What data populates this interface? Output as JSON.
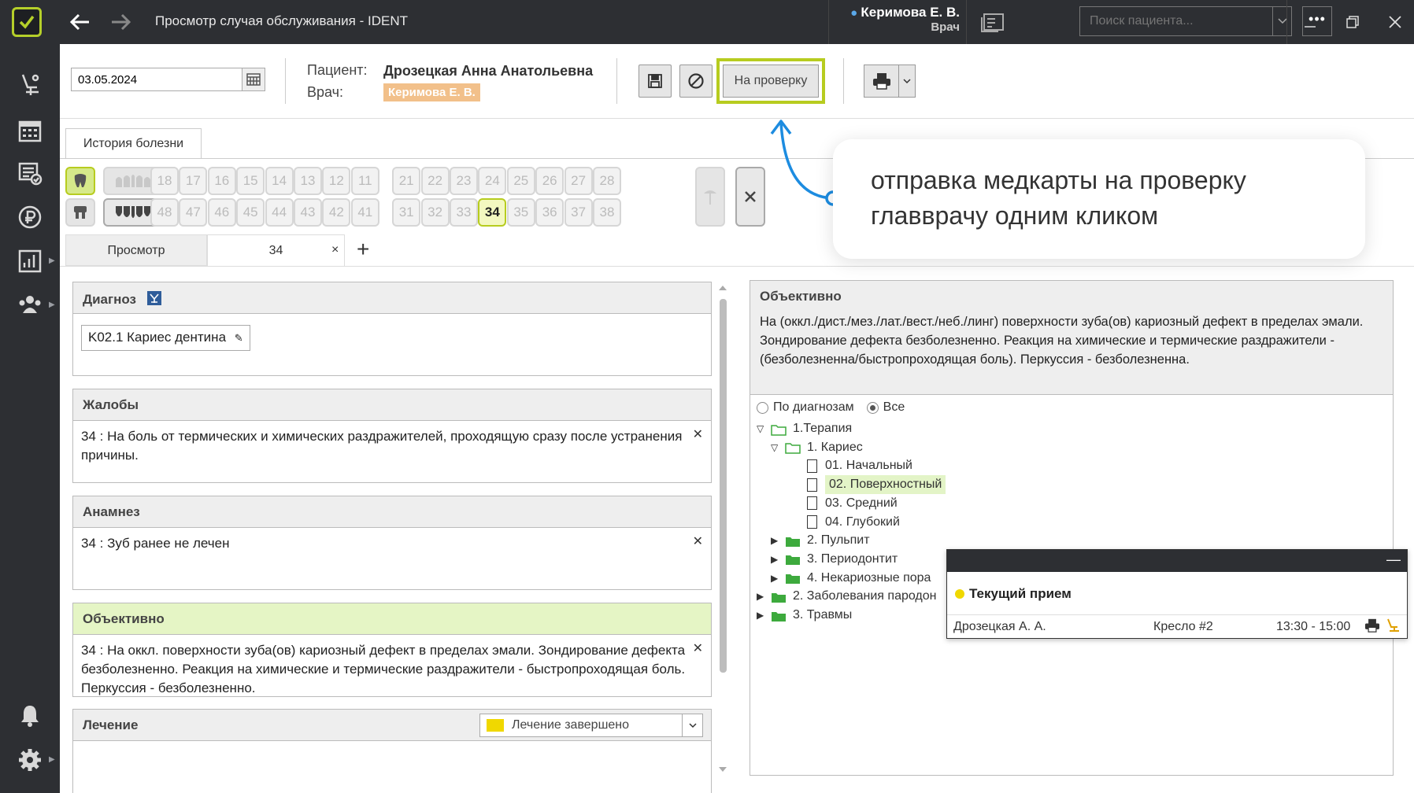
{
  "window": {
    "title": "Просмотр случая обслуживания - IDENT",
    "user_name": "Керимова Е. В.",
    "user_role": "Врач",
    "search_placeholder": "Поиск пациента...",
    "more_label": "•••"
  },
  "header": {
    "date": "03.05.2024",
    "patient_label": "Пациент:",
    "patient_name": "Дрозецкая Анна Анатольевна",
    "doctor_label": "Врач:",
    "doctor_name": "Керимова Е. В.",
    "check_button": "На проверку",
    "doctor_tag_color": "#f2c08a",
    "highlight_color": "#b7cc1f"
  },
  "tabs": {
    "history": "История болезни",
    "view": "Просмотр",
    "tooth_tab": "34",
    "close": "×",
    "add": "+"
  },
  "teeth": {
    "upper": [
      "18",
      "17",
      "16",
      "15",
      "14",
      "13",
      "12",
      "11",
      "21",
      "22",
      "23",
      "24",
      "25",
      "26",
      "27",
      "28"
    ],
    "lower": [
      "48",
      "47",
      "46",
      "45",
      "44",
      "43",
      "42",
      "41",
      "31",
      "32",
      "33",
      "34",
      "35",
      "36",
      "37",
      "38"
    ],
    "selected": "34"
  },
  "panels": {
    "diagnosis": {
      "title": "Диагноз",
      "tag": "K02.1 Кариес дентина"
    },
    "complaints": {
      "title": "Жалобы",
      "text": "34 : На боль от термических и химических раздражителей, проходящую сразу после устранения причины."
    },
    "anamnesis": {
      "title": "Анамнез",
      "text": "34 : Зуб ранее не лечен"
    },
    "objective": {
      "title": "Объективно",
      "text": "34 : На оккл. поверхности зуба(ов) кариозный дефект в пределах эмали. Зондирование дефекта безболезненно. Реакция на химические и термические раздражители - быстропроходящая боль. Перкуссия - безболезненно."
    },
    "treatment": {
      "title": "Лечение",
      "status": "Лечение завершено",
      "status_color": "#f0d800"
    }
  },
  "right": {
    "title": "Объективно",
    "text": "На (оккл./дист./мез./лат./вест./неб./линг) поверхности зуба(ов) кариозный дефект в пределах эмали. Зондирование дефекта безболезненно. Реакция на химические и термические раздражители - (безболезненна/быстропроходящая боль). Перкуссия - безболезненна.",
    "radio_by_diag": "По диагнозам",
    "radio_all": "Все",
    "tree": [
      {
        "label": "1.Терапия",
        "kind": "folder-open",
        "level": 0,
        "arrow": "open"
      },
      {
        "label": "1. Кариес",
        "kind": "folder-open",
        "level": 1,
        "arrow": "open"
      },
      {
        "label": "01. Начальный",
        "kind": "doc",
        "level": 2
      },
      {
        "label": "02. Поверхностный",
        "kind": "doc",
        "level": 2,
        "highlight": true
      },
      {
        "label": "03. Средний",
        "kind": "doc",
        "level": 2
      },
      {
        "label": "04. Глубокий",
        "kind": "doc",
        "level": 2
      },
      {
        "label": "2. Пульпит",
        "kind": "folder",
        "level": 1,
        "arrow": "closed"
      },
      {
        "label": "3. Периодонтит",
        "kind": "folder",
        "level": 1,
        "arrow": "closed"
      },
      {
        "label": "4. Некариозные пора",
        "kind": "folder",
        "level": 1,
        "arrow": "closed"
      },
      {
        "label": "2. Заболевания пародон",
        "kind": "folder",
        "level": 0,
        "arrow": "closed"
      },
      {
        "label": "3. Травмы",
        "kind": "folder",
        "level": 0,
        "arrow": "closed"
      }
    ]
  },
  "popup": {
    "title": "Текущий прием",
    "patient": "Дрозецкая А. А.",
    "chair": "Кресло #2",
    "time": "13:30 - 15:00",
    "minimize": "—"
  },
  "callout": {
    "text": "отправка медкарты на проверку главврачу одним кликом"
  }
}
